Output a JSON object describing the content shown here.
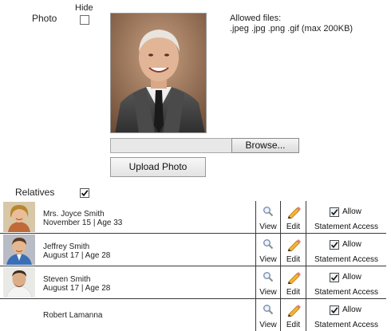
{
  "photo_section": {
    "photo_label": "Photo",
    "hide_label": "Hide",
    "hide_checked": false,
    "allowed_files_label": "Allowed files:",
    "allowed_files_types": ".jpeg .jpg .png .gif (max 200KB)",
    "file_input_value": "",
    "browse_label": "Browse...",
    "upload_label": "Upload Photo"
  },
  "relatives_section": {
    "label": "Relatives",
    "checked": true,
    "actions": {
      "view_label": "View",
      "edit_label": "Edit",
      "allow_label": "Allow",
      "statement_label": "Statement Access"
    },
    "rows": [
      {
        "name": "Mrs. Joyce Smith",
        "date": "November 15",
        "sep": "|",
        "age": "Age 33",
        "avatar": "woman-portrait",
        "allow_checked": true
      },
      {
        "name": "Jeffrey Smith",
        "date": "August 17",
        "sep": "|",
        "age": "Age 28",
        "avatar": "man-portrait-blue-shirt",
        "allow_checked": true
      },
      {
        "name": "Steven Smith",
        "date": "August 17",
        "sep": "|",
        "age": "Age 28",
        "avatar": "man-portrait-white-shirt",
        "allow_checked": true
      },
      {
        "name": "Robert Lamanna",
        "date": "",
        "sep": "",
        "age": "",
        "avatar": "",
        "allow_checked": true
      }
    ]
  },
  "icons": {
    "view": "magnifier-icon",
    "edit": "pencil-icon"
  }
}
